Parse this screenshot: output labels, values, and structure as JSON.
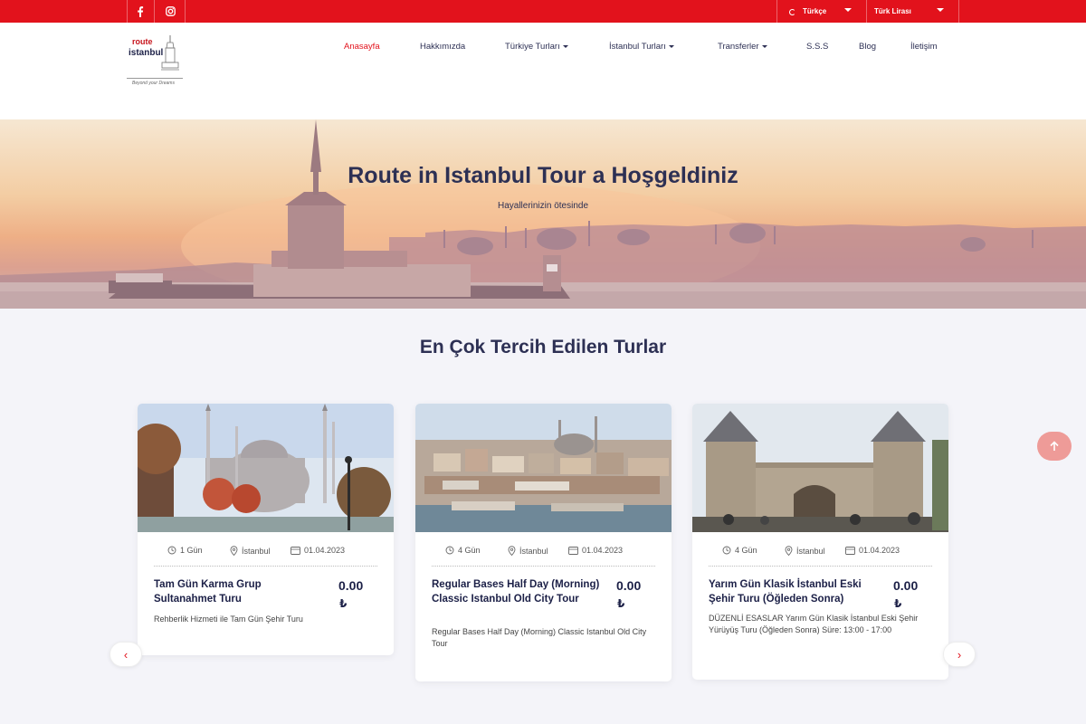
{
  "topbar": {
    "social": [
      "facebook-icon",
      "instagram-icon"
    ],
    "language": "Türkçe",
    "currency": "Türk Lirası",
    "color": "#e2121c"
  },
  "logo": {
    "line1": "route",
    "line2": "istanbul",
    "tagline": "Beyond your Dreams"
  },
  "nav": {
    "home": "Anasayfa",
    "about": "Hakkımızda",
    "turkey_tours": "Türkiye Turları",
    "istanbul_tours": "İstanbul Turları",
    "transfers": "Transferler",
    "faq": "S.S.S",
    "blog": "Blog",
    "contact": "İletişim"
  },
  "hero": {
    "title": "Route in Istanbul Tour a Hoşgeldiniz",
    "subtitle": "Hayallerinizin ötesinde"
  },
  "section": {
    "title": "En Çok Tercih Edilen Turlar"
  },
  "cards": [
    {
      "duration": "1 Gün",
      "location": "İstanbul",
      "date": "01.04.2023",
      "title": "Tam Gün Karma Grup Sultanahmet Turu",
      "price": "0.00",
      "currency": "₺",
      "description": "Rehberlik Hizmeti ile Tam Gün Şehir Turu"
    },
    {
      "duration": "4 Gün",
      "location": "İstanbul",
      "date": "01.04.2023",
      "title": "Regular Bases Half Day (Morning) Classic Istanbul Old City Tour",
      "price": "0.00",
      "currency": "₺",
      "description": "Regular Bases Half Day (Morning) Classic Istanbul Old City Tour"
    },
    {
      "duration": "4 Gün",
      "location": "İstanbul",
      "date": "01.04.2023",
      "title": "Yarım Gün Klasik İstanbul Eski Şehir Turu (Öğleden Sonra)",
      "price": "0.00",
      "currency": "₺",
      "description": "DÜZENLİ ESASLAR Yarım Gün Klasik İstanbul Eski Şehir Yürüyüş Turu (Öğleden Sonra) Süre: 13:00 - 17:00"
    }
  ],
  "carousel": {
    "prev": "‹",
    "next": "›"
  }
}
